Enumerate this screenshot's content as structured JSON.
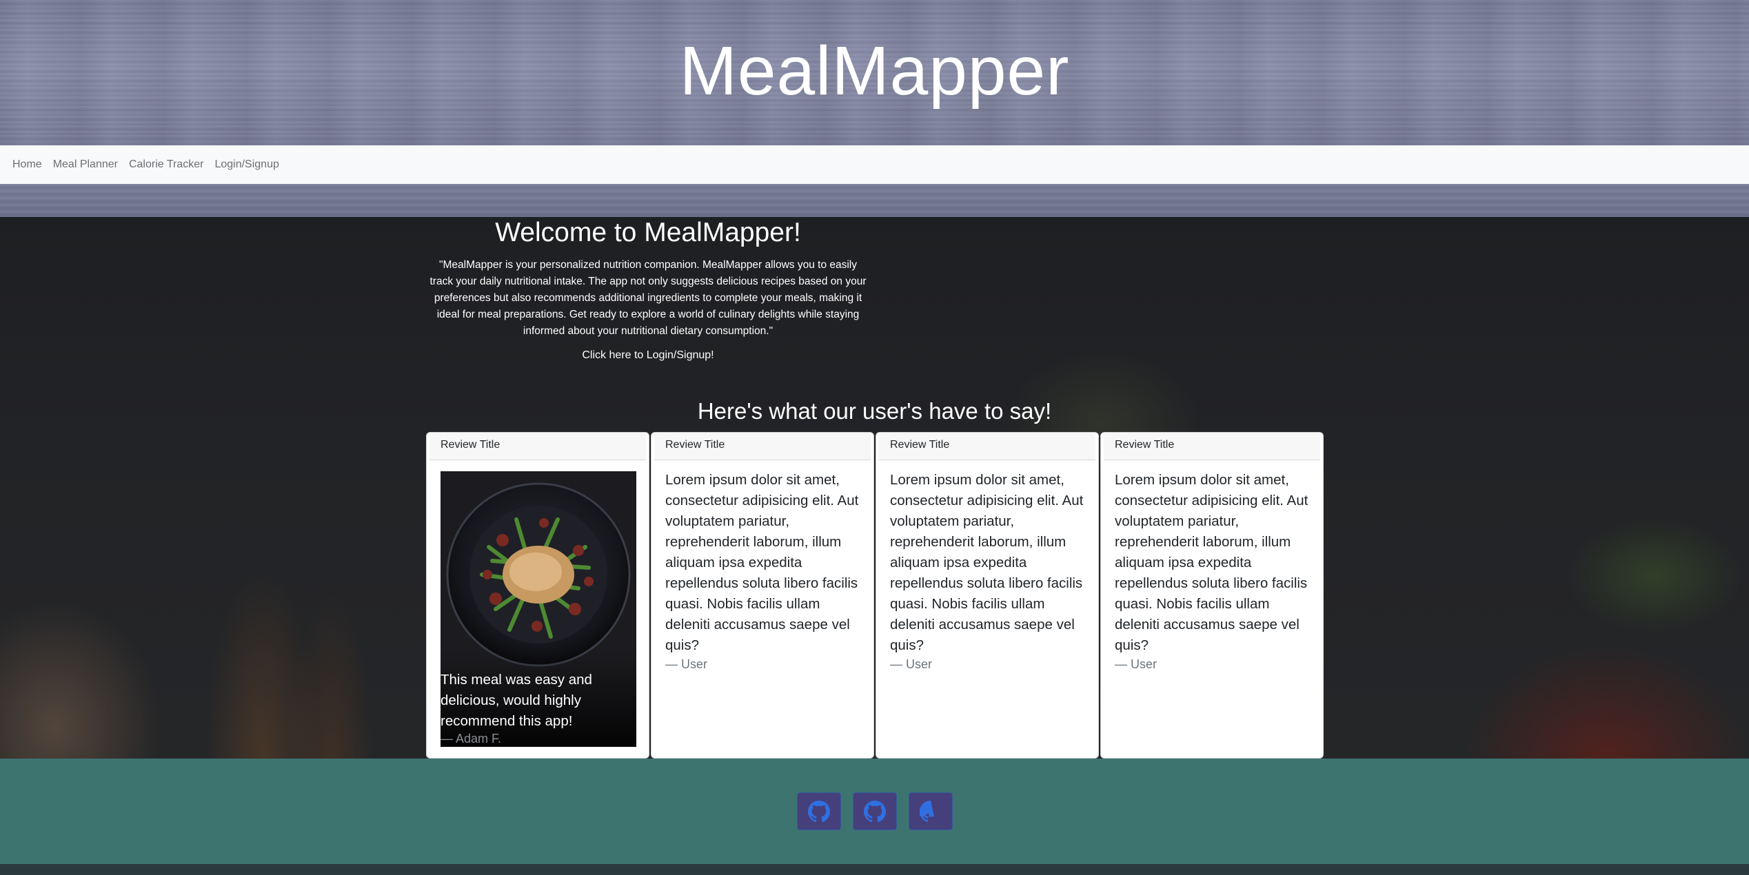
{
  "header": {
    "title": "MealMapper"
  },
  "nav": {
    "items": [
      {
        "label": "Home"
      },
      {
        "label": "Meal Planner"
      },
      {
        "label": "Calorie Tracker"
      },
      {
        "label": "Login/Signup"
      }
    ]
  },
  "hero": {
    "title": "Welcome to MealMapper!",
    "description": "\"MealMapper is your personalized nutrition companion. MealMapper allows you to easily track your daily nutritional intake. The app not only suggests delicious recipes based on your preferences but also recommends additional ingredients to complete your meals, making it ideal for meal preparations. Get ready to explore a world of culinary delights while staying informed about your nutritional dietary consumption.\"",
    "login_link": "Click here to Login/Signup!"
  },
  "reviews": {
    "heading": "Here's what our user's have to say!",
    "cards": [
      {
        "title": "Review Title",
        "text": "This meal was easy and delicious, would highly recommend this app!",
        "author": "— Adam F.",
        "image": "plated-chicken-green-beans-photo"
      },
      {
        "title": "Review Title",
        "text": "Lorem ipsum dolor sit amet, consectetur adipisicing elit. Aut voluptatem pariatur, reprehenderit laborum, illum aliquam ipsa expedita repellendus soluta libero facilis quasi. Nobis facilis ullam deleniti accusamus saepe vel quis?",
        "author": "— User"
      },
      {
        "title": "Review Title",
        "text": "Lorem ipsum dolor sit amet, consectetur adipisicing elit. Aut voluptatem pariatur, reprehenderit laborum, illum aliquam ipsa expedita repellendus soluta libero facilis quasi. Nobis facilis ullam deleniti accusamus saepe vel quis?",
        "author": "— User"
      },
      {
        "title": "Review Title",
        "text": "Lorem ipsum dolor sit amet, consectetur adipisicing elit. Aut voluptatem pariatur, reprehenderit laborum, illum aliquam ipsa expedita repellendus soluta libero facilis quasi. Nobis facilis ullam deleniti accusamus saepe vel quis?",
        "author": "— User"
      }
    ]
  },
  "footer": {
    "icons": [
      "github-icon",
      "github-icon",
      "github-icon"
    ],
    "button_color": "#453f7c",
    "icon_color": "#2f6fe0",
    "background": "#3e7470"
  }
}
